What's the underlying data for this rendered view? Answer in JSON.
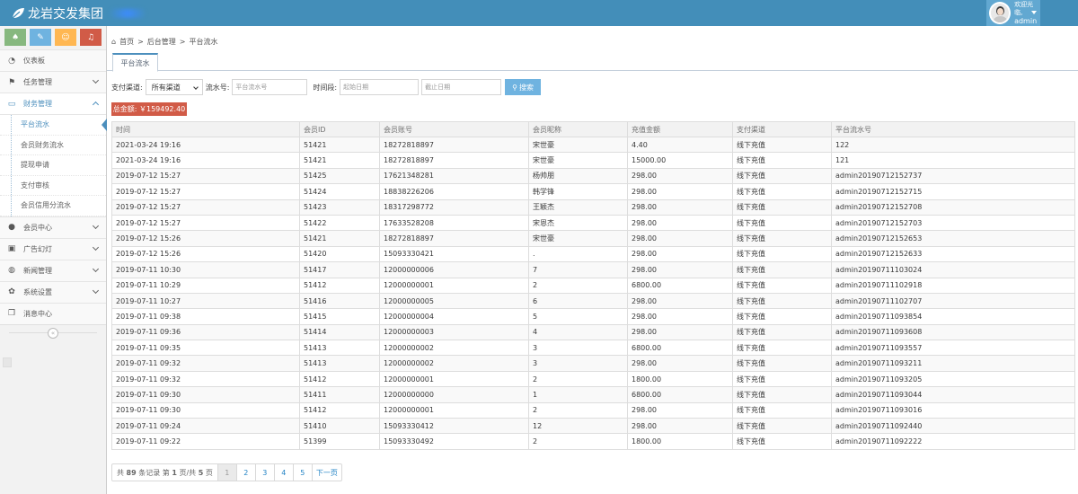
{
  "brand": {
    "title": "龙岩交发集团"
  },
  "user": {
    "welcome": "欢迎光临,",
    "name": "admin"
  },
  "sidebar": {
    "items": [
      {
        "icon": "dashboard-icon",
        "glyph": "◔",
        "label": "仪表板"
      },
      {
        "icon": "flag-icon",
        "glyph": "⚑",
        "label": "任务管理"
      },
      {
        "icon": "finance-icon",
        "glyph": "▭",
        "label": "财务管理"
      },
      {
        "icon": "user-icon",
        "glyph": "●",
        "label": "会员中心"
      },
      {
        "icon": "picture-icon",
        "glyph": "▣",
        "label": "广告幻灯"
      },
      {
        "icon": "globe-icon",
        "glyph": "◍",
        "label": "新闻管理"
      },
      {
        "icon": "cog-icon",
        "glyph": "✿",
        "label": "系统设置"
      },
      {
        "icon": "bookmark-icon",
        "glyph": "❐",
        "label": "消息中心"
      }
    ],
    "finance_sub": [
      "平台流水",
      "会员财务流水",
      "提现申请",
      "支付审核",
      "会员信用分流水"
    ]
  },
  "breadcrumb": {
    "home": "首页",
    "sep": ">",
    "level1": "后台管理",
    "level2": "平台流水"
  },
  "tab": {
    "label": "平台流水"
  },
  "filters": {
    "channel_label": "支付渠道:",
    "channel_value": "所有渠道",
    "serial_label": "流水号:",
    "serial_placeholder": "平台流水号",
    "period_label": "时间段:",
    "start_placeholder": "起始日期",
    "end_placeholder": "截止日期",
    "search_label": "搜索"
  },
  "total": {
    "label": "总金额: ￥159492.40"
  },
  "table": {
    "headers": [
      "时间",
      "会员ID",
      "会员账号",
      "会员昵称",
      "充值金额",
      "支付渠道",
      "平台流水号"
    ],
    "rows": [
      [
        "2021-03-24 19:16",
        "51421",
        "18272818897",
        "宋世豪",
        "4.40",
        "线下充值",
        "122"
      ],
      [
        "2021-03-24 19:16",
        "51421",
        "18272818897",
        "宋世豪",
        "15000.00",
        "线下充值",
        "121"
      ],
      [
        "2019-07-12 15:27",
        "51425",
        "17621348281",
        "杨帅朋",
        "298.00",
        "线下充值",
        "admin20190712152737"
      ],
      [
        "2019-07-12 15:27",
        "51424",
        "18838226206",
        "韩学锋",
        "298.00",
        "线下充值",
        "admin20190712152715"
      ],
      [
        "2019-07-12 15:27",
        "51423",
        "18317298772",
        "王颖杰",
        "298.00",
        "线下充值",
        "admin20190712152708"
      ],
      [
        "2019-07-12 15:27",
        "51422",
        "17633528208",
        "宋恩杰",
        "298.00",
        "线下充值",
        "admin20190712152703"
      ],
      [
        "2019-07-12 15:26",
        "51421",
        "18272818897",
        "宋世豪",
        "298.00",
        "线下充值",
        "admin20190712152653"
      ],
      [
        "2019-07-12 15:26",
        "51420",
        "15093330421",
        ".",
        "298.00",
        "线下充值",
        "admin20190712152633"
      ],
      [
        "2019-07-11 10:30",
        "51417",
        "12000000006",
        "7",
        "298.00",
        "线下充值",
        "admin20190711103024"
      ],
      [
        "2019-07-11 10:29",
        "51412",
        "12000000001",
        "2",
        "6800.00",
        "线下充值",
        "admin20190711102918"
      ],
      [
        "2019-07-11 10:27",
        "51416",
        "12000000005",
        "6",
        "298.00",
        "线下充值",
        "admin20190711102707"
      ],
      [
        "2019-07-11 09:38",
        "51415",
        "12000000004",
        "5",
        "298.00",
        "线下充值",
        "admin20190711093854"
      ],
      [
        "2019-07-11 09:36",
        "51414",
        "12000000003",
        "4",
        "298.00",
        "线下充值",
        "admin20190711093608"
      ],
      [
        "2019-07-11 09:35",
        "51413",
        "12000000002",
        "3",
        "6800.00",
        "线下充值",
        "admin20190711093557"
      ],
      [
        "2019-07-11 09:32",
        "51413",
        "12000000002",
        "3",
        "298.00",
        "线下充值",
        "admin20190711093211"
      ],
      [
        "2019-07-11 09:32",
        "51412",
        "12000000001",
        "2",
        "1800.00",
        "线下充值",
        "admin20190711093205"
      ],
      [
        "2019-07-11 09:30",
        "51411",
        "12000000000",
        "1",
        "6800.00",
        "线下充值",
        "admin20190711093044"
      ],
      [
        "2019-07-11 09:30",
        "51412",
        "12000000001",
        "2",
        "298.00",
        "线下充值",
        "admin20190711093016"
      ],
      [
        "2019-07-11 09:24",
        "51410",
        "15093330412",
        "12",
        "298.00",
        "线下充值",
        "admin20190711092440"
      ],
      [
        "2019-07-11 09:22",
        "51399",
        "15093330492",
        "2",
        "1800.00",
        "线下充值",
        "admin20190711092222"
      ]
    ]
  },
  "pager": {
    "prefix": "共",
    "total": "89",
    "mid1": "条记录 第",
    "page": "1",
    "mid2": "页/共",
    "pages": "5",
    "suffix": "页",
    "numbers": [
      "1",
      "2",
      "3",
      "4",
      "5"
    ],
    "current": "1",
    "next": "下一页"
  }
}
